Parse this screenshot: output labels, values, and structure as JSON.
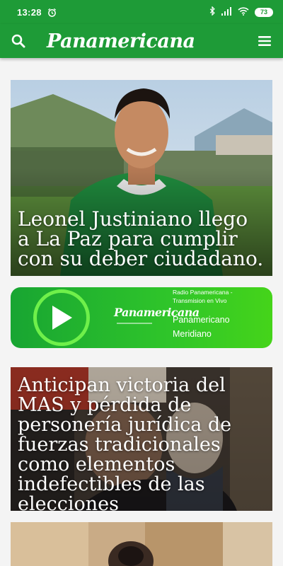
{
  "status_bar": {
    "time": "13:28",
    "battery": "73"
  },
  "header": {
    "brand": "Panamericana"
  },
  "articles": [
    {
      "headline": "Leonel Justiniano llego a La Paz para cumplir con su deber ciudadano."
    },
    {
      "headline": "Anticipan victoria del MAS y pérdida de personería jurídica de fuerzas tradicionales como elementos indefectibles de las elecciones"
    }
  ],
  "player": {
    "logo": "Panamericana",
    "station": "Radio Panamericana - Transmision en Vivo",
    "program": "Panamericano Meridiano"
  },
  "colors": {
    "brand_green": "#1e9b37",
    "player_green": "#2fc52a",
    "play_ring": "#6ff04a"
  }
}
